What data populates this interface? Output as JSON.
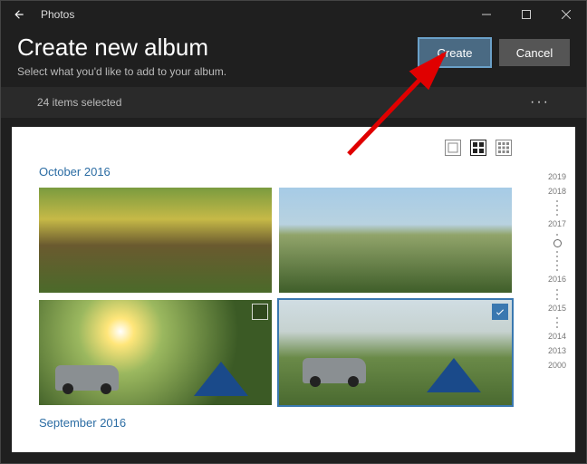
{
  "titlebar": {
    "app": "Photos"
  },
  "header": {
    "title": "Create new album",
    "subtitle": "Select what you'd like to add to your album.",
    "create": "Create",
    "cancel": "Cancel"
  },
  "selection": {
    "label": "24 items selected"
  },
  "sections": {
    "s1": "October 2016",
    "s2": "September 2016"
  },
  "timeline": {
    "y2019": "2019",
    "y2018": "2018",
    "y2017": "2017",
    "y2016": "2016",
    "y2015": "2015",
    "y2014": "2014",
    "y2013": "2013",
    "y2000": "2000"
  }
}
